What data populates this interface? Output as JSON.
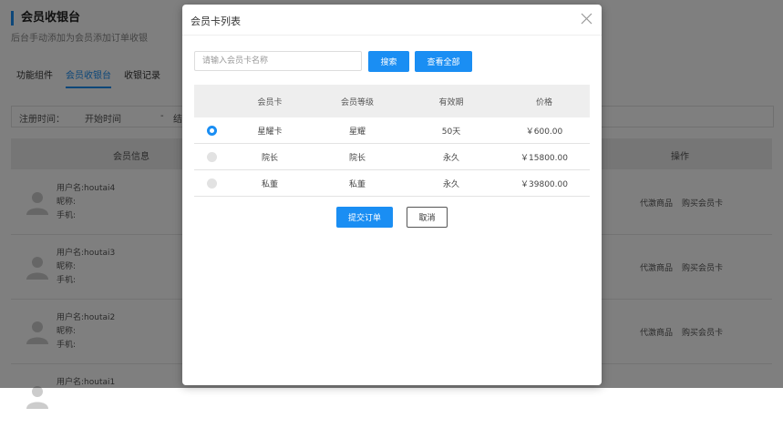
{
  "page": {
    "title": "会员收银台",
    "subtitle": "后台手动添加为会员添加订单收银",
    "tabs": [
      {
        "label": "功能组件",
        "active": false
      },
      {
        "label": "会员收银台",
        "active": true
      },
      {
        "label": "收银记录",
        "active": false
      }
    ],
    "filter": {
      "reg_label": "注册时间：",
      "start_placeholder": "开始时间",
      "separator": "-",
      "end_placeholder": "结"
    },
    "table": {
      "col_member_info": "会员信息",
      "col_actions": "操作",
      "rows": [
        {
          "username": "用户名:houtai4",
          "nickname": "昵称:",
          "phone": "手机:",
          "action1": "代激商品",
          "action2": "购买会员卡"
        },
        {
          "username": "用户名:houtai3",
          "nickname": "昵称:",
          "phone": "手机:",
          "action1": "代激商品",
          "action2": "购买会员卡"
        },
        {
          "username": "用户名:houtai2",
          "nickname": "昵称:",
          "phone": "手机:",
          "action1": "代激商品",
          "action2": "购买会员卡"
        },
        {
          "username": "用户名:houtai1",
          "nickname": "",
          "phone": "",
          "action1": "",
          "action2": ""
        }
      ]
    }
  },
  "modal": {
    "title": "会员卡列表",
    "search_placeholder": "请输入会员卡名称",
    "search_value": "",
    "search_button": "搜索",
    "view_all_button": "查看全部",
    "columns": [
      "",
      "会员卡",
      "会员等级",
      "有效期",
      "价格"
    ],
    "rows": [
      {
        "selected": true,
        "card": "星耀卡",
        "level": "星耀",
        "validity": "50天",
        "price": "￥600.00"
      },
      {
        "selected": false,
        "card": "院长",
        "level": "院长",
        "validity": "永久",
        "price": "￥15800.00"
      },
      {
        "selected": false,
        "card": "私董",
        "level": "私董",
        "validity": "永久",
        "price": "￥39800.00"
      }
    ],
    "submit_button": "提交订单",
    "cancel_button": "取消"
  },
  "colors": {
    "accent": "#1a8ef3",
    "overlay": "rgba(0,0,0,0.5)"
  },
  "icons": {
    "close": "close-icon",
    "avatar": "user-avatar-icon"
  }
}
